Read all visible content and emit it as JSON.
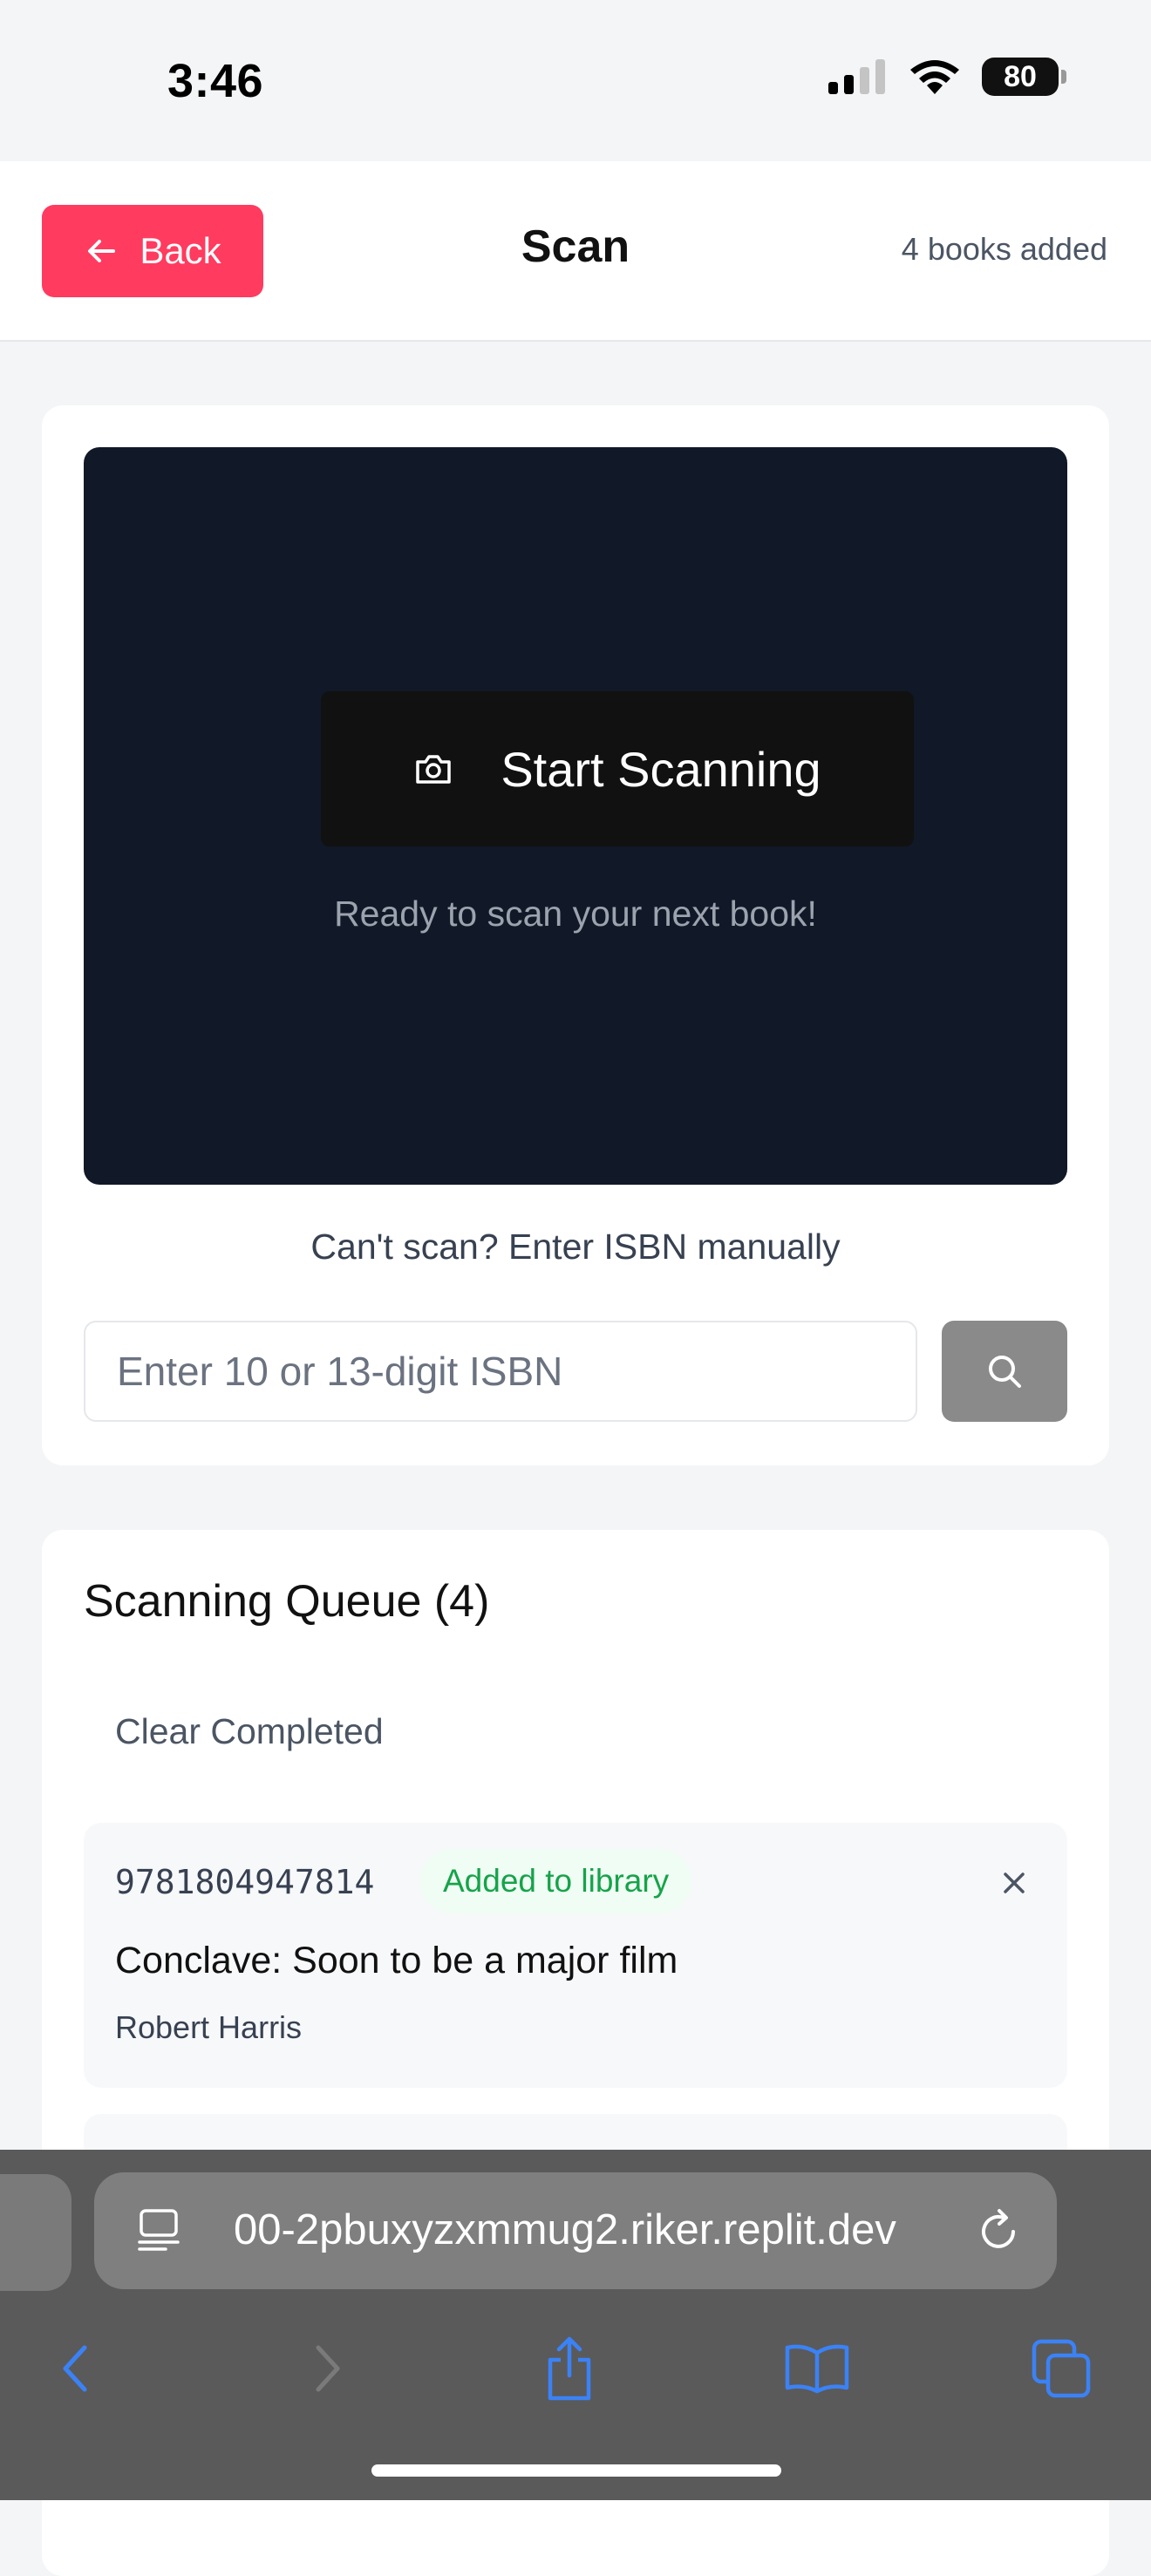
{
  "status_bar": {
    "time": "3:46",
    "battery": "80"
  },
  "header": {
    "back_label": "Back",
    "title": "Scan",
    "books_added": "4 books added"
  },
  "scanner": {
    "start_label": "Start Scanning",
    "ready_text": "Ready to scan your next book!",
    "manual_label": "Can't scan? Enter ISBN manually",
    "isbn_placeholder": "Enter 10 or 13-digit ISBN"
  },
  "queue": {
    "title": "Scanning Queue (4)",
    "clear_label": "Clear Completed",
    "items": [
      {
        "isbn": "9781804947814",
        "status": "Added to library",
        "title": "Conclave: Soon to be a major film",
        "author": "Robert Harris"
      }
    ]
  },
  "browser": {
    "url": "00-2pbuxyzxmmug2.riker.replit.dev",
    "accent": "#3b82f6"
  },
  "colors": {
    "brand": "#ff3b5f",
    "camera_bg": "#111827",
    "success": "#16a34a"
  }
}
